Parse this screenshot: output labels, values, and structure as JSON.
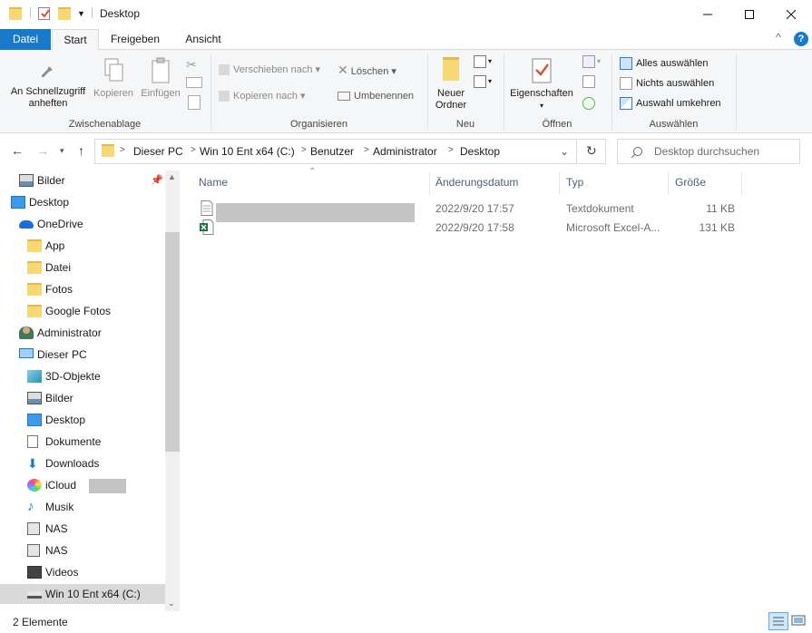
{
  "window": {
    "title": "Desktop",
    "buttons": {
      "minimize": "—",
      "maximize": "☐",
      "close": "✕"
    },
    "collapse_ribbon": "^",
    "help": "?"
  },
  "tabs": [
    "Datei",
    "Start",
    "Freigeben",
    "Ansicht"
  ],
  "ribbon": {
    "clipboard": {
      "pin_label": "An Schnellzugriff anheften",
      "copy_label": "Kopieren",
      "paste_label": "Einfügen",
      "group_label": "Zwischenablage"
    },
    "organize": {
      "move_label": "Verschieben nach",
      "copy_to_label": "Kopieren nach",
      "delete_label": "Löschen",
      "rename_label": "Umbenennen",
      "group_label": "Organisieren"
    },
    "new": {
      "new_folder_label": "Neuer Ordner",
      "group_label": "Neu"
    },
    "open": {
      "properties_label": "Eigenschaften",
      "group_label": "Öffnen"
    },
    "select": {
      "select_all": "Alles auswählen",
      "select_none": "Nichts auswählen",
      "invert": "Auswahl umkehren",
      "group_label": "Auswählen"
    }
  },
  "address": {
    "crumbs": [
      "Dieser PC",
      "Win 10 Ent x64 (C:)",
      "Benutzer",
      "Administrator",
      "Desktop"
    ],
    "search_placeholder": "Desktop durchsuchen"
  },
  "nav_items": [
    {
      "label": "Bilder",
      "icon": "pictures-icon"
    },
    {
      "label": "Desktop",
      "icon": "desktop-icon"
    },
    {
      "label": "OneDrive",
      "icon": "onedrive-icon"
    },
    {
      "label": "App",
      "icon": "folder-icon"
    },
    {
      "label": "Datei",
      "icon": "folder-icon"
    },
    {
      "label": "Fotos",
      "icon": "folder-icon"
    },
    {
      "label": "Google Fotos",
      "icon": "folder-icon"
    },
    {
      "label": "Administrator",
      "icon": "user-icon"
    },
    {
      "label": "Dieser PC",
      "icon": "pc-icon"
    },
    {
      "label": "3D-Objekte",
      "icon": "3d-objects-icon"
    },
    {
      "label": "Bilder",
      "icon": "pictures-icon"
    },
    {
      "label": "Desktop",
      "icon": "desktop-icon"
    },
    {
      "label": "Dokumente",
      "icon": "documents-icon"
    },
    {
      "label": "Downloads",
      "icon": "downloads-icon"
    },
    {
      "label": "iCloud",
      "icon": "icloud-icon"
    },
    {
      "label": "Musik",
      "icon": "music-icon"
    },
    {
      "label": "NAS",
      "icon": "nas-icon"
    },
    {
      "label": "NAS",
      "icon": "nas-icon"
    },
    {
      "label": "Videos",
      "icon": "videos-icon"
    },
    {
      "label": "Win 10 Ent x64 (C:)",
      "icon": "drive-icon"
    }
  ],
  "columns": {
    "name": "Name",
    "date": "Änderungsdatum",
    "type": "Typ",
    "size": "Größe"
  },
  "files": [
    {
      "date": "2022/9/20 17:57",
      "type": "Textdokument",
      "size": "11 KB",
      "icon": "text-file-icon"
    },
    {
      "date": "2022/9/20 17:58",
      "type": "Microsoft Excel-A...",
      "size": "131 KB",
      "icon": "excel-file-icon"
    }
  ],
  "status": "2 Elemente",
  "colors": {
    "accent": "#1979ca",
    "folder": "#f8d775",
    "selected_bg": "#cce8ff"
  }
}
